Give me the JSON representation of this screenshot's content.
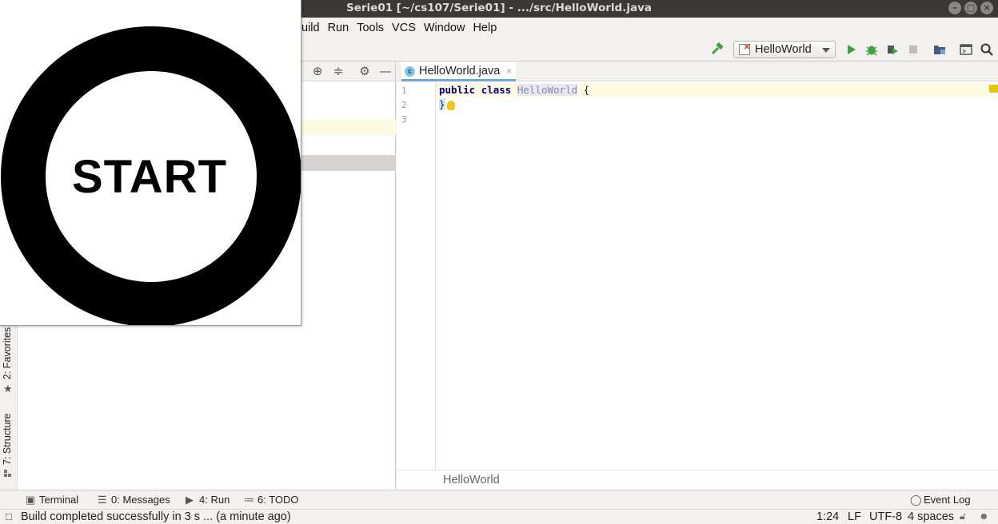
{
  "window": {
    "title": "Serie01 [~/cs107/Serie01] - .../src/HelloWorld.java"
  },
  "menubar": {
    "items": [
      {
        "label": "Build",
        "visible": "uild"
      },
      {
        "label": "Run"
      },
      {
        "label": "Tools"
      },
      {
        "label": "VCS"
      },
      {
        "label": "Window"
      },
      {
        "label": "Help"
      }
    ]
  },
  "toolbar": {
    "run_config": "HelloWorld"
  },
  "left_strip": {
    "favorites": "2: Favorites",
    "structure": "7: Structure"
  },
  "editor": {
    "tab_label": "HelloWorld.java",
    "tab_icon_letter": "c",
    "line_numbers": [
      "1",
      "2",
      "3"
    ],
    "code": {
      "kw_public": "public",
      "kw_class": "class",
      "class_name": "HelloWorld",
      "open_brace": "{",
      "close_brace": "}"
    },
    "breadcrumb": "HelloWorld"
  },
  "bottom_tabs": {
    "terminal": "Terminal",
    "messages": "0: Messages",
    "run": "4: Run",
    "todo": "6: TODO",
    "event_log": "Event Log"
  },
  "statusbar": {
    "message": "Build completed successfully in 3 s ... (a minute ago)",
    "position": "1:24",
    "line_sep": "LF",
    "encoding": "UTF-8",
    "indent": "4 spaces"
  },
  "overlay": {
    "label": "START"
  },
  "colors": {
    "accent_run": "#3ea33e",
    "tab_underline": "#6fa8dc",
    "keyword": "#000080"
  }
}
